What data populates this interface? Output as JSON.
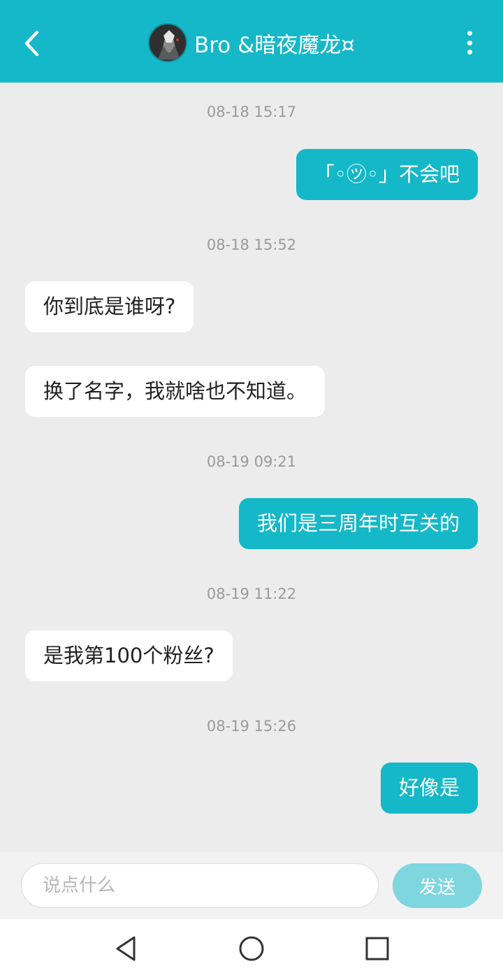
{
  "header": {
    "title": "Bro &暗夜魔龙¤",
    "back_icon": "chevron-left-icon",
    "more_icon": "more-vertical-icon",
    "background": "#14b8c8"
  },
  "messages": [
    {
      "type": "timestamp",
      "text": "08-18 15:17"
    },
    {
      "type": "outgoing",
      "text": "「◦㋡◦」不会吧"
    },
    {
      "type": "timestamp",
      "text": "08-18 15:52"
    },
    {
      "type": "incoming",
      "text": "你到底是谁呀?"
    },
    {
      "type": "incoming",
      "text": "换了名字，我就啥也不知道。"
    },
    {
      "type": "timestamp",
      "text": "08-19 09:21"
    },
    {
      "type": "outgoing",
      "text": "我们是三周年时互关的"
    },
    {
      "type": "timestamp",
      "text": "08-19 11:22"
    },
    {
      "type": "incoming",
      "text": "是我第100个粉丝?"
    },
    {
      "type": "timestamp",
      "text": "08-19 15:26"
    },
    {
      "type": "outgoing",
      "text": "好像是"
    }
  ],
  "input": {
    "placeholder": "说点什么",
    "value": "",
    "send_label": "发送"
  },
  "nav": {
    "back_icon": "triangle-back-icon",
    "home_icon": "circle-home-icon",
    "recents_icon": "square-recents-icon"
  },
  "colors": {
    "accent": "#14b8c8",
    "send_disabled": "#7fd6df",
    "chat_background": "#ececec"
  }
}
